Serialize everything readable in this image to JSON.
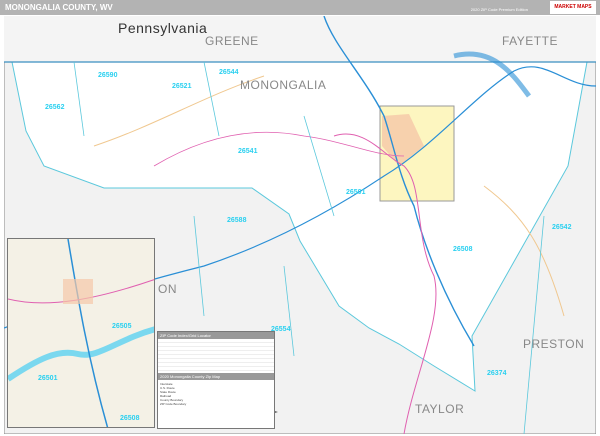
{
  "header": {
    "title": "MONONGALIA COUNTY, WV",
    "edition": "2020 ZIP Code Premium Edition",
    "logo": "MARKET MAPS"
  },
  "regions": {
    "state": "Pennsylvania",
    "greene": "GREENE",
    "fayette": "FAYETTE",
    "county": "MONONGALIA",
    "marion": "ON",
    "preston": "PRESTON",
    "taylor": "TAYLOR"
  },
  "zips": [
    "26590",
    "26544",
    "26521",
    "26562",
    "26541",
    "26501",
    "26588",
    "26508",
    "26542",
    "26554",
    "26374"
  ],
  "inset": {
    "zips": [
      "26505",
      "26501",
      "26508"
    ]
  },
  "legend": {
    "table_title": "ZIP Code Index/Grid Locator",
    "map_key_title": "2020 Monongalia County Zip Map",
    "rows": [
      "Interstate",
      "U.S. Route",
      "State Route",
      "Railroad",
      "County Boundary",
      "ZIP Code Boundary"
    ]
  },
  "colors": {
    "zip": "#2ad0f0",
    "interstate": "#2a8fd6",
    "state_route": "#e060b0",
    "county_road": "#f0c890",
    "outside": "#f2f2f2"
  }
}
